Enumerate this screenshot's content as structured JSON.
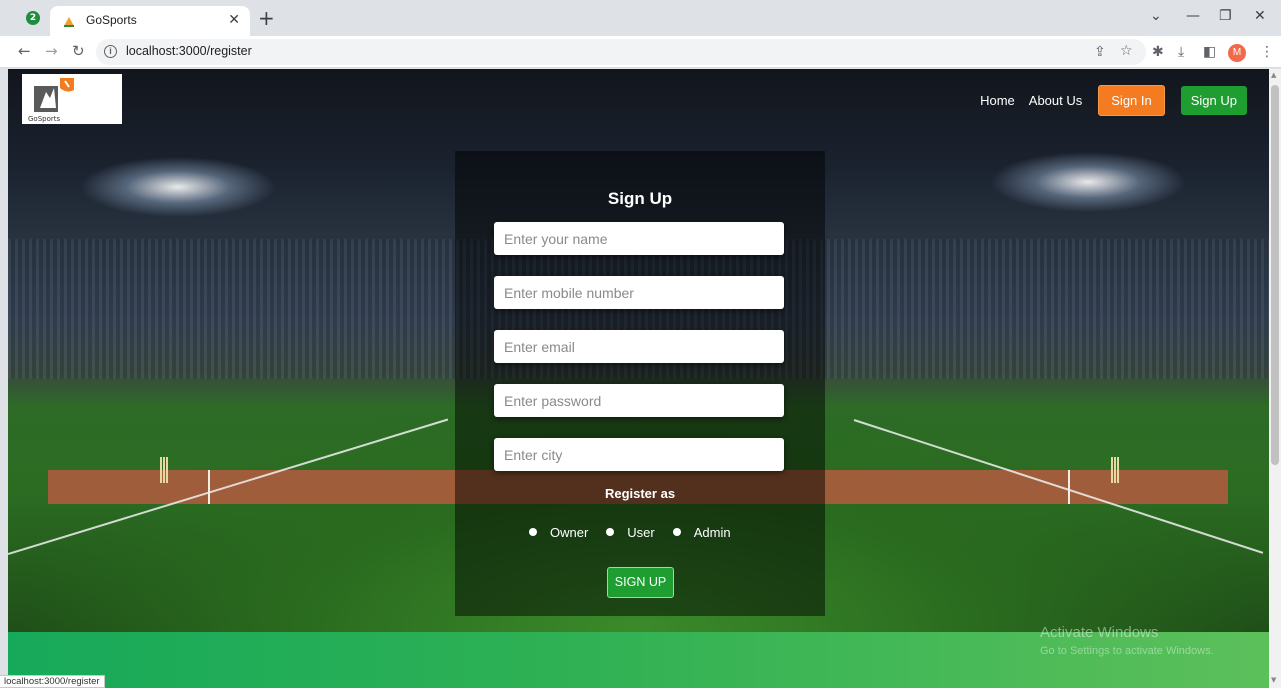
{
  "browser": {
    "tab_count": "2",
    "tab_title": "GoSports",
    "url": "localhost:3000/register",
    "profile_initial": "M",
    "status_url": "localhost:3000/register"
  },
  "site": {
    "logo_text": "GoSports",
    "nav": {
      "home": "Home",
      "about": "About Us",
      "sign_in": "Sign In",
      "sign_up": "Sign Up"
    }
  },
  "form": {
    "title": "Sign Up",
    "name_placeholder": "Enter your name",
    "mobile_placeholder": "Enter mobile number",
    "email_placeholder": "Enter email",
    "password_placeholder": "Enter password",
    "city_placeholder": "Enter city",
    "register_as_label": "Register as",
    "roles": [
      "Owner",
      "User",
      "Admin"
    ],
    "submit_label": "SIGN UP"
  },
  "watermark": {
    "title": "Activate Windows",
    "subtitle": "Go to Settings to activate Windows."
  },
  "colors": {
    "sign_in_button": "#f47b20",
    "sign_up_button": "#1e9e31",
    "footer_band": "#2fb154"
  }
}
